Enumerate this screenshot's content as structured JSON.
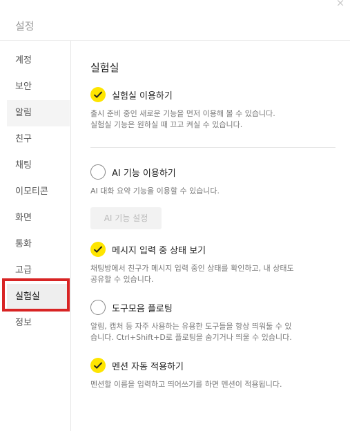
{
  "window": {
    "title": "설정",
    "close_glyph": "×"
  },
  "sidebar": {
    "items": [
      {
        "label": "계정"
      },
      {
        "label": "보안"
      },
      {
        "label": "알림"
      },
      {
        "label": "친구"
      },
      {
        "label": "채팅"
      },
      {
        "label": "이모티콘"
      },
      {
        "label": "화면"
      },
      {
        "label": "통화"
      },
      {
        "label": "고급"
      },
      {
        "label": "실험실"
      },
      {
        "label": "정보"
      }
    ],
    "active": "실험실",
    "hovered": "알림"
  },
  "lab": {
    "title": "실험실",
    "options": [
      {
        "label": "실험실 이용하기",
        "checked": true,
        "desc": [
          "출시 준비 중인 새로운 기능을 먼저 이용해 볼 수 있습니다.",
          "실험실 기능은 원하실 때 끄고 켜실 수 있습니다."
        ]
      },
      {
        "label": "AI 기능 이용하기",
        "checked": false,
        "desc": [
          "AI 대화 요약 기능을 이용할 수 있습니다."
        ],
        "button_label": "AI 기능 설정",
        "button_enabled": false
      },
      {
        "label": "메시지 입력 중 상태 보기",
        "checked": true,
        "desc": [
          "채팅방에서 친구가 메시지 입력 중인 상태를 확인하고, 내 상태도",
          "공유할 수 있습니다."
        ]
      },
      {
        "label": "도구모음 플로팅",
        "checked": false,
        "desc": [
          "알림, 캡처 등 자주 사용하는 유용한 도구들을 항상 띄워둘 수 있",
          "습니다. Ctrl+Shift+D로 플로팅을 숨기거나 띄울 수 있습니다."
        ]
      },
      {
        "label": "멘션 자동 적용하기",
        "checked": true,
        "desc": [
          "멘션할 이름을 입력하고 띄어쓰기를 하면 멘션이 적용됩니다."
        ]
      }
    ]
  },
  "colors": {
    "check_on": "#fee500",
    "highlight": "#d82424"
  }
}
